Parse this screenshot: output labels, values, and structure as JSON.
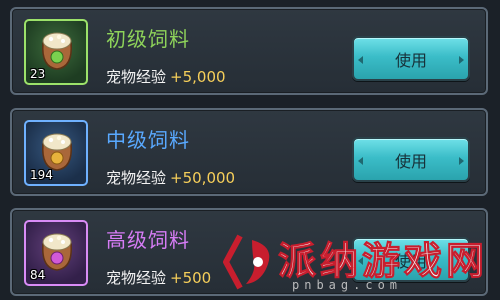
{
  "items": [
    {
      "name": "初级饲料",
      "exp_label": "宠物经验",
      "exp_value": "+5,000",
      "count": "23",
      "button_label": "使用",
      "rarity_color": "#8ed35a"
    },
    {
      "name": "中级饲料",
      "exp_label": "宠物经验",
      "exp_value": "+50,000",
      "count": "194",
      "button_label": "使用",
      "rarity_color": "#59a9ff"
    },
    {
      "name": "高级饲料",
      "exp_label": "宠物经验",
      "exp_value": "+500",
      "count": "84",
      "button_label": "使用",
      "rarity_color": "#d67cf5"
    }
  ],
  "watermark": {
    "text": "派纳游戏网",
    "subtext": "pnbag.com",
    "icon": "pnbag-logo-icon"
  }
}
